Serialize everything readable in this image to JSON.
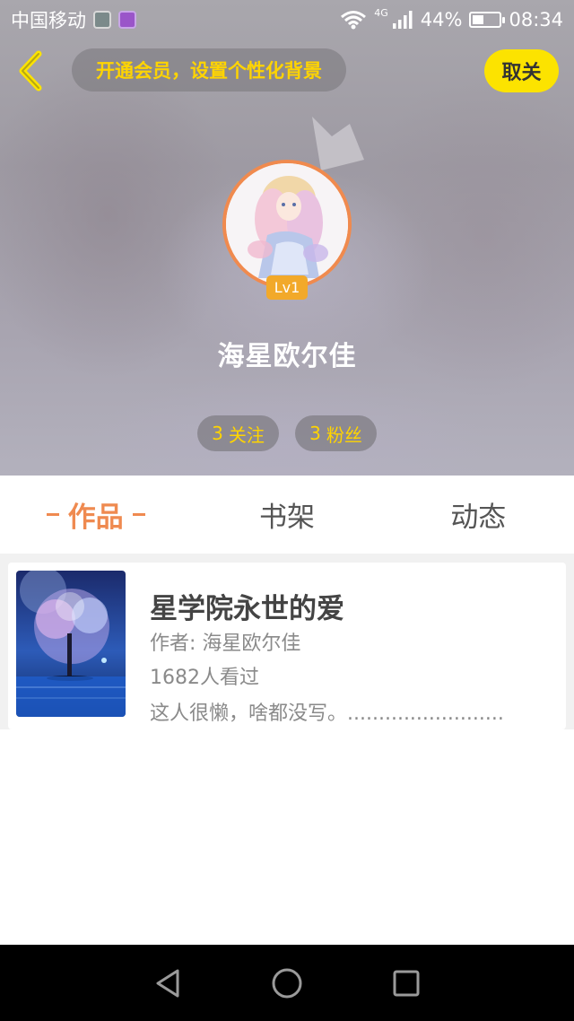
{
  "status_bar": {
    "carrier": "中国移动",
    "network_type": "4G",
    "battery": "44%",
    "battery_level": 0.44,
    "time": "08:34",
    "icons": [
      "app-notification-icon",
      "gallery-notification-icon",
      "wifi-icon",
      "signal-icon",
      "battery-icon"
    ]
  },
  "header": {
    "vip_prompt": "开通会员，设置个性化背景",
    "unfollow_label": "取关",
    "level_badge": "Lv1",
    "user_name": "海星欧尔佳",
    "stats": {
      "following_count": "3",
      "following_label": "关注",
      "fans_count": "3",
      "fans_label": "粉丝"
    }
  },
  "tabs": [
    {
      "label": "作品",
      "active": true
    },
    {
      "label": "书架",
      "active": false
    },
    {
      "label": "动态",
      "active": false
    }
  ],
  "works": [
    {
      "title": "星学院永世的爱",
      "author": "作者: 海星欧尔佳",
      "views": "1682人看过",
      "description": "这人很懒，啥都没写。........................."
    }
  ],
  "colors": {
    "accent_yellow": "#fce300",
    "accent_orange": "#ef8a50",
    "level_badge": "#f2a92a",
    "nav_bar": "#000000"
  },
  "nav_bar": {
    "icons": [
      "back-triangle-icon",
      "home-circle-icon",
      "recents-square-icon"
    ]
  }
}
